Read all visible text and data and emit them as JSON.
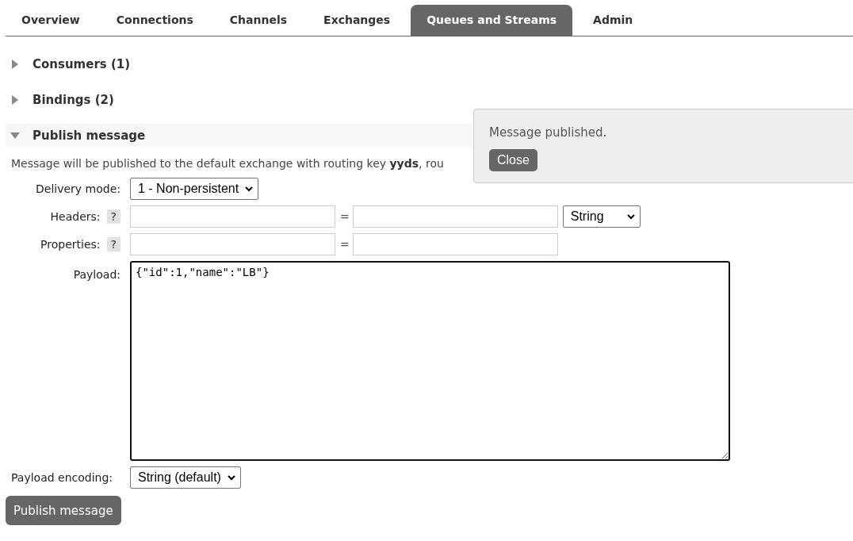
{
  "tabs": [
    {
      "label": "Overview",
      "selected": false
    },
    {
      "label": "Connections",
      "selected": false
    },
    {
      "label": "Channels",
      "selected": false
    },
    {
      "label": "Exchanges",
      "selected": false
    },
    {
      "label": "Queues and Streams",
      "selected": true
    },
    {
      "label": "Admin",
      "selected": false
    }
  ],
  "sections": [
    {
      "title": "Consumers (1)",
      "expanded": false
    },
    {
      "title": "Bindings (2)",
      "expanded": false
    },
    {
      "title": "Publish message",
      "expanded": true
    }
  ],
  "publish": {
    "description": "Message will be published to the default exchange with routing key **yyds**, rou",
    "delivery_mode": {
      "label": "Delivery mode:",
      "value": "1 - Non-persistent"
    },
    "headers": {
      "label": "Headers:",
      "help": "?",
      "equals": "=",
      "type": "String"
    },
    "properties": {
      "label": "Properties:",
      "help": "?",
      "equals": "="
    },
    "payload": {
      "label": "Payload:",
      "value": "{\"id\":1,\"name\":\"LB\"}"
    },
    "encoding": {
      "label": "Payload encoding:",
      "value": "String (default)"
    },
    "button": "Publish message"
  },
  "notification": {
    "message": "Message published.",
    "button": "Close"
  }
}
